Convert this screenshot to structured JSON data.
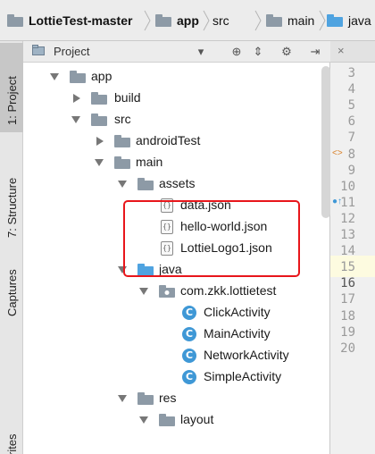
{
  "breadcrumb": {
    "items": [
      {
        "label": "LottieTest-master",
        "icon": "project-folder-icon"
      },
      {
        "label": "app",
        "icon": "module-folder-icon"
      },
      {
        "label": "src",
        "icon": "folder-icon"
      },
      {
        "label": "main",
        "icon": "folder-icon"
      },
      {
        "label": "java",
        "icon": "source-folder-icon"
      }
    ]
  },
  "tool_strip": {
    "tabs": [
      {
        "label": "1: Project",
        "active": true
      },
      {
        "label": "7: Structure",
        "active": false
      },
      {
        "label": "Captures",
        "active": false
      },
      {
        "label": "rites",
        "active": false
      }
    ]
  },
  "panel": {
    "title": "Project",
    "icons": [
      "dropdown-icon",
      "target-icon",
      "collapse-icon",
      "gear-icon",
      "hide-icon"
    ]
  },
  "tree": {
    "items": [
      {
        "label": "app",
        "arrow": "down",
        "icon": "module-folder-icon"
      },
      {
        "label": "build",
        "arrow": "right",
        "icon": "folder-icon"
      },
      {
        "label": "src",
        "arrow": "down",
        "icon": "folder-icon"
      },
      {
        "label": "androidTest",
        "arrow": "right",
        "icon": "folder-icon"
      },
      {
        "label": "main",
        "arrow": "down",
        "icon": "folder-icon"
      },
      {
        "label": "assets",
        "arrow": "down",
        "icon": "assets-folder-icon"
      },
      {
        "label": "data.json",
        "arrow": "",
        "icon": "json-file-icon"
      },
      {
        "label": "hello-world.json",
        "arrow": "",
        "icon": "json-file-icon"
      },
      {
        "label": "LottieLogo1.json",
        "arrow": "",
        "icon": "json-file-icon"
      },
      {
        "label": "java",
        "arrow": "down",
        "icon": "source-folder-icon"
      },
      {
        "label": "com.zkk.lottietest",
        "arrow": "down",
        "icon": "package-icon"
      },
      {
        "label": "ClickActivity",
        "arrow": "",
        "icon": "class-icon"
      },
      {
        "label": "MainActivity",
        "arrow": "",
        "icon": "class-icon"
      },
      {
        "label": "NetworkActivity",
        "arrow": "",
        "icon": "class-icon"
      },
      {
        "label": "SimpleActivity",
        "arrow": "",
        "icon": "class-icon"
      },
      {
        "label": "res",
        "arrow": "down",
        "icon": "res-folder-icon"
      },
      {
        "label": "layout",
        "arrow": "down",
        "icon": "folder-icon"
      }
    ]
  },
  "editor": {
    "close_label": "×",
    "line_numbers": [
      "3",
      "4",
      "5",
      "6",
      "7",
      "8",
      "9",
      "10",
      "11",
      "12",
      "13",
      "14",
      "15",
      "16",
      "17",
      "18",
      "19",
      "20"
    ],
    "current_line": "16"
  },
  "colors": {
    "highlight_box": "#e8161b",
    "class_icon": "#3f98d6",
    "folder": "#8d9aa6",
    "source_folder": "#4fa3e0",
    "current_line_bg": "#fdfbe0"
  }
}
